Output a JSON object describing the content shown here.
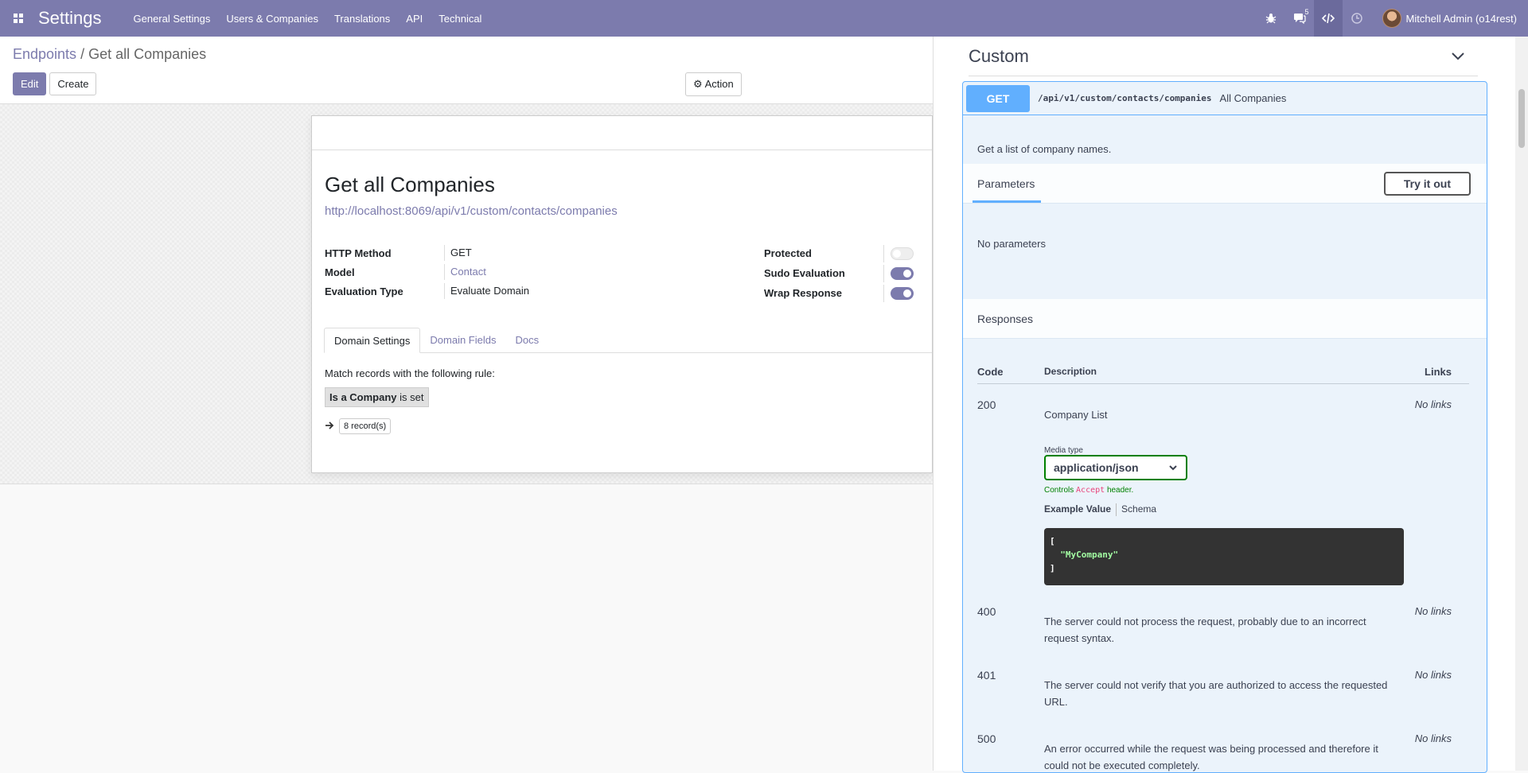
{
  "navbar": {
    "app_title": "Settings",
    "menu": [
      "General Settings",
      "Users & Companies",
      "Translations",
      "API",
      "Technical"
    ],
    "messages_badge": "5",
    "user_name": "Mitchell Admin (o14rest)"
  },
  "control_panel": {
    "breadcrumb_parent": "Endpoints",
    "breadcrumb_separator": "/",
    "breadcrumb_current": "Get all Companies",
    "edit_label": "Edit",
    "create_label": "Create",
    "action_label": "Action"
  },
  "form": {
    "title": "Get all Companies",
    "url": "http://localhost:8069/api/v1/custom/contacts/companies",
    "fields": [
      {
        "label": "HTTP Method",
        "value": "GET"
      },
      {
        "label": "Model",
        "value": "Contact"
      },
      {
        "label": "Evaluation Type",
        "value": "Evaluate Domain"
      }
    ],
    "toggles": [
      {
        "label": "Protected",
        "on": false
      },
      {
        "label": "Sudo Evaluation",
        "on": true
      },
      {
        "label": "Wrap Response",
        "on": true
      }
    ],
    "tabs": [
      "Domain Settings",
      "Domain Fields",
      "Docs"
    ],
    "domain_rule_text": "Match records with the following rule:",
    "domain_field": "Is a Company",
    "domain_operator": "is set",
    "record_count": "8 record(s)"
  },
  "swagger": {
    "section_title": "Custom",
    "method": "GET",
    "path": "/api/v1/custom/contacts/companies",
    "summary": "All Companies",
    "description": "Get a list of company names.",
    "parameters_tab": "Parameters",
    "try_button": "Try it out",
    "no_parameters": "No parameters",
    "responses_label": "Responses",
    "table_headers": {
      "code": "Code",
      "description": "Description",
      "links": "Links"
    },
    "media_type_label": "Media type",
    "media_type_value": "application/json",
    "controls_prefix": "Controls",
    "controls_accept": "Accept",
    "controls_suffix": "header.",
    "example_value_tab": "Example Value",
    "schema_tab": "Schema",
    "example_open": "[",
    "example_string": "\"MyCompany\"",
    "example_close": "]",
    "responses": [
      {
        "code": "200",
        "description": "Company List",
        "links": "No links"
      },
      {
        "code": "400",
        "description": "The server could not process the request, probably due to an incorrect request syntax.",
        "links": "No links"
      },
      {
        "code": "401",
        "description": "The server could not verify that you are authorized to access the requested URL.",
        "links": "No links"
      },
      {
        "code": "500",
        "description": "An error occurred while the request was being processed and therefore it could not be executed completely.",
        "links": "No links"
      }
    ]
  },
  "colors": {
    "brand": "#7c7bad",
    "get_method": "#61affe",
    "get_background": "#ebf3fb",
    "media_select_border": "#008000"
  }
}
